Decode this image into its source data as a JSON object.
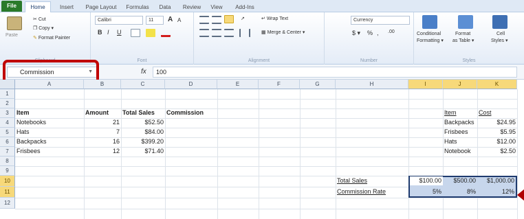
{
  "tabs": [
    "File",
    "Home",
    "Insert",
    "Page Layout",
    "Formulas",
    "Data",
    "Review",
    "View",
    "Add-Ins"
  ],
  "ribbon": {
    "clipboard": {
      "paste": "Paste",
      "cut": "Cut",
      "copy": "Copy ▾",
      "format_painter": "Format Painter",
      "label": "Clipboard"
    },
    "font": {
      "name": "Calibri",
      "size": "11",
      "bold": "B",
      "italic": "I",
      "underline": "U",
      "grow": "A",
      "shrink": "A",
      "label": "Font"
    },
    "alignment": {
      "wrap_text": "Wrap Text",
      "merge_center": "Merge & Center ▾",
      "label": "Alignment"
    },
    "number": {
      "format": "Currency",
      "dollar": "$ ▾",
      "percent": "%",
      "comma": ",",
      "inc_dec": ".00",
      "label": "Number"
    },
    "styles": {
      "conditional": "Conditional",
      "conditional2": "Formatting ▾",
      "format_table": "Format",
      "format_table2": "as Table ▾",
      "cell_styles": "Cell",
      "cell_styles2": "Styles ▾",
      "label": "Styles"
    }
  },
  "formula_bar": {
    "name_box": "Commission",
    "fx": "fx",
    "formula": "100"
  },
  "columns": [
    "A",
    "B",
    "C",
    "D",
    "E",
    "F",
    "G",
    "H",
    "I",
    "J",
    "K"
  ],
  "rows": [
    "1",
    "2",
    "3",
    "4",
    "5",
    "6",
    "7",
    "8",
    "9",
    "10",
    "11",
    "12"
  ],
  "table": {
    "headers": {
      "item": "Item",
      "amount": "Amount",
      "total_sales": "Total Sales",
      "commission": "Commission"
    },
    "rows": [
      {
        "item": "Notebooks",
        "amount": "21",
        "total": "$52.50"
      },
      {
        "item": "Hats",
        "amount": "7",
        "total": "$84.00"
      },
      {
        "item": "Backpacks",
        "amount": "16",
        "total": "$399.20"
      },
      {
        "item": "Frisbees",
        "amount": "12",
        "total": "$71.40"
      }
    ]
  },
  "price_list": {
    "item_header": "Item",
    "cost_header": "Cost",
    "rows": [
      {
        "item": "Backpacks",
        "cost": "$24.95"
      },
      {
        "item": "Frisbees",
        "cost": "$5.95"
      },
      {
        "item": "Hats",
        "cost": "$12.00"
      },
      {
        "item": "Notebook",
        "cost": "$2.50"
      }
    ]
  },
  "commission_table": {
    "total_sales_label": "Total Sales",
    "commission_rate_label": "Commission Rate",
    "total_sales": [
      "$100.00",
      "$500.00",
      "$1,000.00"
    ],
    "rates": [
      "5%",
      "8%",
      "12%"
    ]
  },
  "colors": {
    "file_tab": "#2a7a2a",
    "highlight_outline": "#c00000",
    "selection": "#c7d6ec"
  }
}
